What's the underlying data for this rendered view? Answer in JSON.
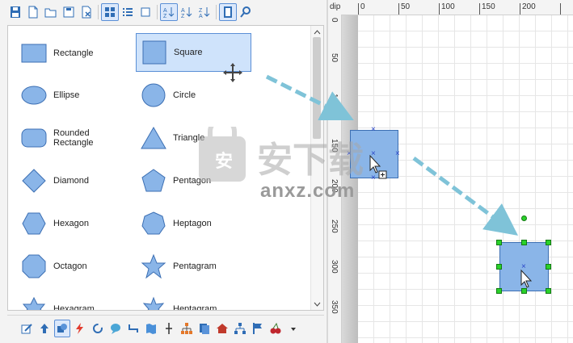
{
  "left_toolbar": {
    "icons": [
      "save-icon",
      "new-page-icon",
      "open-folder-icon",
      "save-as-icon",
      "delete-page-icon",
      "large-icons-view-icon",
      "list-view-icon",
      "small-view-icon",
      "sort-az-icon",
      "sort-az-asc-icon",
      "sort-za-desc-icon",
      "book-icon",
      "search-icon"
    ]
  },
  "shapes": [
    {
      "label": "Rectangle"
    },
    {
      "label": "Square"
    },
    {
      "label": "Ellipse"
    },
    {
      "label": "Circle"
    },
    {
      "label": "Rounded Rectangle"
    },
    {
      "label": "Triangle"
    },
    {
      "label": "Diamond"
    },
    {
      "label": "Pentagon"
    },
    {
      "label": "Hexagon"
    },
    {
      "label": "Heptagon"
    },
    {
      "label": "Octagon"
    },
    {
      "label": "Pentagram"
    },
    {
      "label": "Hexagram"
    },
    {
      "label": "Heptagram"
    }
  ],
  "selected_shape": "Square",
  "bottom_toolbar": {
    "icons": [
      "edit-icon",
      "pointer-up-icon",
      "shapes-icon",
      "lightning-icon",
      "refresh-icon",
      "speech-bubble-icon",
      "connector-icon",
      "map-icon",
      "vertical-split-icon",
      "org-chart-icon",
      "pages-icon",
      "house-icon",
      "hierarchy-icon",
      "flag-icon",
      "cherry-icon",
      "more-dropdown-icon"
    ]
  },
  "ruler": {
    "unit": "dip",
    "top_labels": [
      "0",
      "50",
      "100",
      "150",
      "200"
    ],
    "left_labels": [
      "0",
      "50",
      "100",
      "150",
      "200",
      "250",
      "300",
      "350"
    ]
  },
  "watermark": {
    "text": "anxz.com"
  },
  "colors": {
    "shape_fill": "#8ab5e8",
    "shape_stroke": "#3c6fb3",
    "handle": "#2ad12a",
    "selection": "#cfe3fb",
    "arrow": "#7fc3d8"
  }
}
